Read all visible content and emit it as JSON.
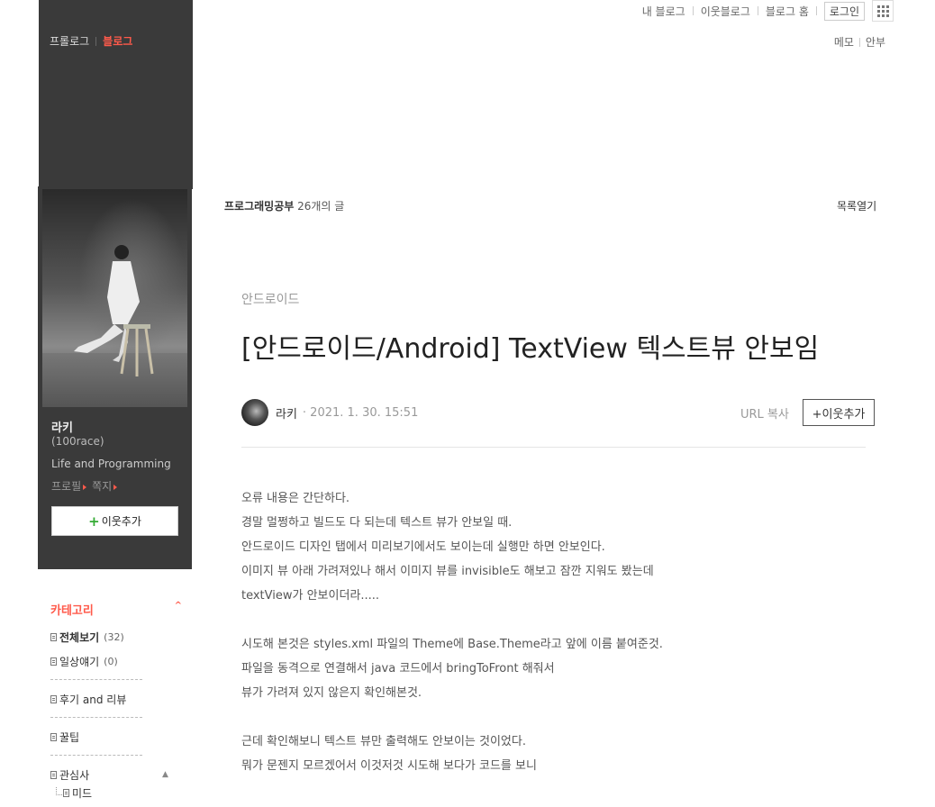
{
  "gnb": {
    "my_blog": "내 블로그",
    "neighbor_blog": "이웃블로그",
    "blog_home": "블로그 홈",
    "login": "로그인"
  },
  "util": {
    "memo": "메모",
    "notice": "안부"
  },
  "sidebar": {
    "tab_prologue": "프롤로그",
    "tab_blog": "블로그",
    "nickname": "라키",
    "blog_id": "(100race)",
    "description": "Life and Programming",
    "profile_link": "프로필",
    "message_link": "쪽지",
    "add_neighbor": "이웃추가",
    "category_title": "카테고리",
    "categories": [
      {
        "label": "전체보기",
        "count": "(32)"
      },
      {
        "label": "일상얘기",
        "count": "(0)"
      },
      {
        "label": "후기 and 리뷰"
      },
      {
        "label": "꿀팁"
      },
      {
        "label": "관심사"
      },
      {
        "label": "미드"
      }
    ]
  },
  "main": {
    "category_name": "프로그래밍공부",
    "post_count": "26개의 글",
    "list_open": "목록열기",
    "post_category": "안드로이드",
    "post_title": "[안드로이드/Android]  TextView 텍스트뷰 안보임",
    "author": "라키",
    "date": "· 2021. 1. 30. 15:51",
    "url_copy": "URL 복사",
    "add_neighbor": "+이웃추가",
    "paragraphs": [
      "오류 내용은 간단하다.",
      "경말 멀쩡하고 빌드도 다 되는데 텍스트 뷰가 안보일 때.",
      "안드로이드 디자인 탭에서 미리보기에서도 보이는데 실행만 하면 안보인다.",
      "이미지 뷰 아래 가려져있나 해서 이미지 뷰를 invisible도 해보고 잠깐 지워도 봤는데",
      "textView가 안보이더라.....",
      "",
      "시도해 본것은 styles.xml 파일의 Theme에 Base.Theme라고 앞에 이름 붙여준것.",
      "파일을 동격으로 연결해서 java 코드에서 bringToFront 해줘서",
      "뷰가 가려져 있지 않은지 확인해본것.",
      "",
      "근데 확인해보니 텍스트 뷰만 출력해도 안보이는 것이었다.",
      "뭐가 문젠지 모르겠어서 이것저것 시도해 보다가 코드를 보니"
    ]
  }
}
